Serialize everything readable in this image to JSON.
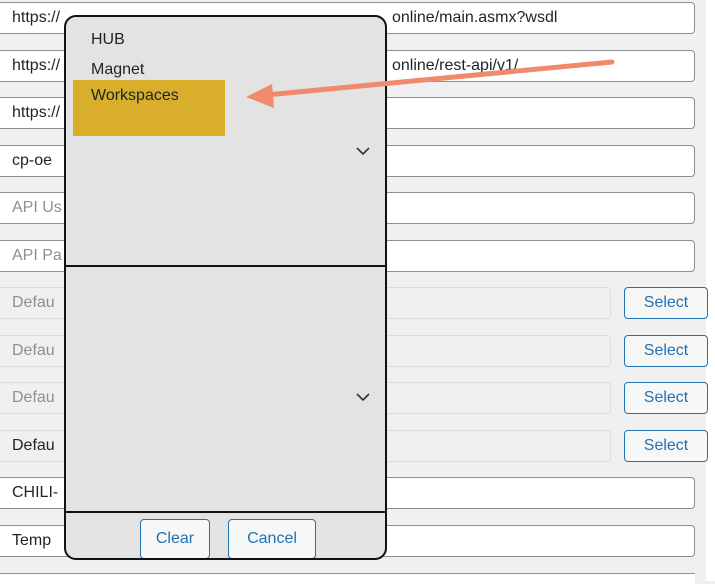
{
  "fields": [
    {
      "text": "https://",
      "value_suffix": "online/main.asmx?wsdl"
    },
    {
      "text": "https://",
      "value_suffix": "online/rest-api/v1/"
    },
    {
      "text": "https://"
    },
    {
      "text": "cp-oe"
    },
    {
      "text": "API Us"
    },
    {
      "text": "API Pa"
    },
    {
      "text": "Defau"
    },
    {
      "text": "Defau"
    },
    {
      "text": "Defau"
    },
    {
      "text": "Defau"
    },
    {
      "text": "CHILI-"
    },
    {
      "text": "Temp"
    }
  ],
  "select_button_label": "Select",
  "dropdown": {
    "options": [
      "HUB",
      "Magnet",
      "Workspaces"
    ],
    "selected": "Workspaces",
    "clear_label": "Clear",
    "cancel_label": "Cancel"
  },
  "colors": {
    "selected_option": "#d9ae2b",
    "arrow": "#f08a6c",
    "link_blue": "#2271b1"
  }
}
